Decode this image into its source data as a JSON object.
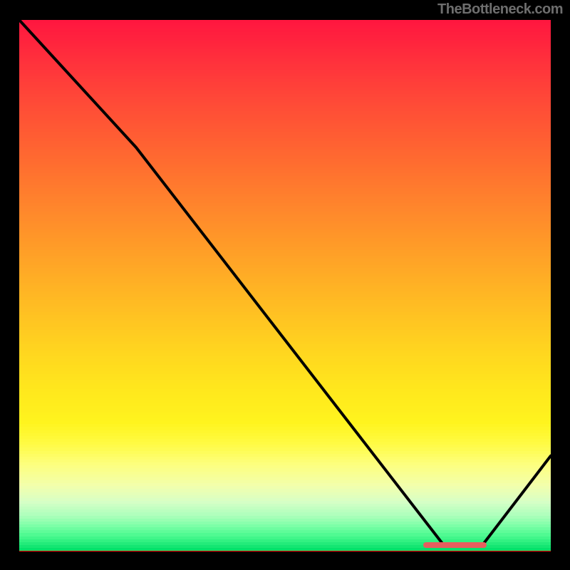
{
  "attribution": "TheBottleneck.com",
  "colors": {
    "background": "#000000",
    "line": "#000000",
    "marker": "#e65e5e"
  },
  "chart_data": {
    "type": "line",
    "title": "",
    "xlabel": "",
    "ylabel": "",
    "xlim": [
      0,
      100
    ],
    "ylim": [
      0,
      100
    ],
    "series": [
      {
        "name": "curve",
        "x": [
          0,
          22,
          80,
          87,
          100
        ],
        "y": [
          100,
          76,
          1,
          1,
          18
        ]
      }
    ],
    "gradient_stops": [
      {
        "pos": 0.0,
        "color": "#ff173f"
      },
      {
        "pos": 0.07,
        "color": "#ff2f3c"
      },
      {
        "pos": 0.14,
        "color": "#ff4638"
      },
      {
        "pos": 0.21,
        "color": "#ff5b33"
      },
      {
        "pos": 0.28,
        "color": "#ff702f"
      },
      {
        "pos": 0.35,
        "color": "#ff852c"
      },
      {
        "pos": 0.42,
        "color": "#ff9a28"
      },
      {
        "pos": 0.49,
        "color": "#ffaf25"
      },
      {
        "pos": 0.56,
        "color": "#ffc322"
      },
      {
        "pos": 0.63,
        "color": "#ffd71f"
      },
      {
        "pos": 0.7,
        "color": "#ffe81d"
      },
      {
        "pos": 0.76,
        "color": "#fff41e"
      },
      {
        "pos": 0.8,
        "color": "#fffb44"
      },
      {
        "pos": 0.84,
        "color": "#fdff80"
      },
      {
        "pos": 0.88,
        "color": "#f2ffad"
      },
      {
        "pos": 0.91,
        "color": "#d6ffc6"
      },
      {
        "pos": 0.935,
        "color": "#aeffbc"
      },
      {
        "pos": 0.955,
        "color": "#7dffa7"
      },
      {
        "pos": 0.975,
        "color": "#48f98e"
      },
      {
        "pos": 1.0,
        "color": "#05e06a"
      }
    ],
    "marker": {
      "x_start": 76,
      "x_end": 88,
      "y": 1.2
    }
  }
}
